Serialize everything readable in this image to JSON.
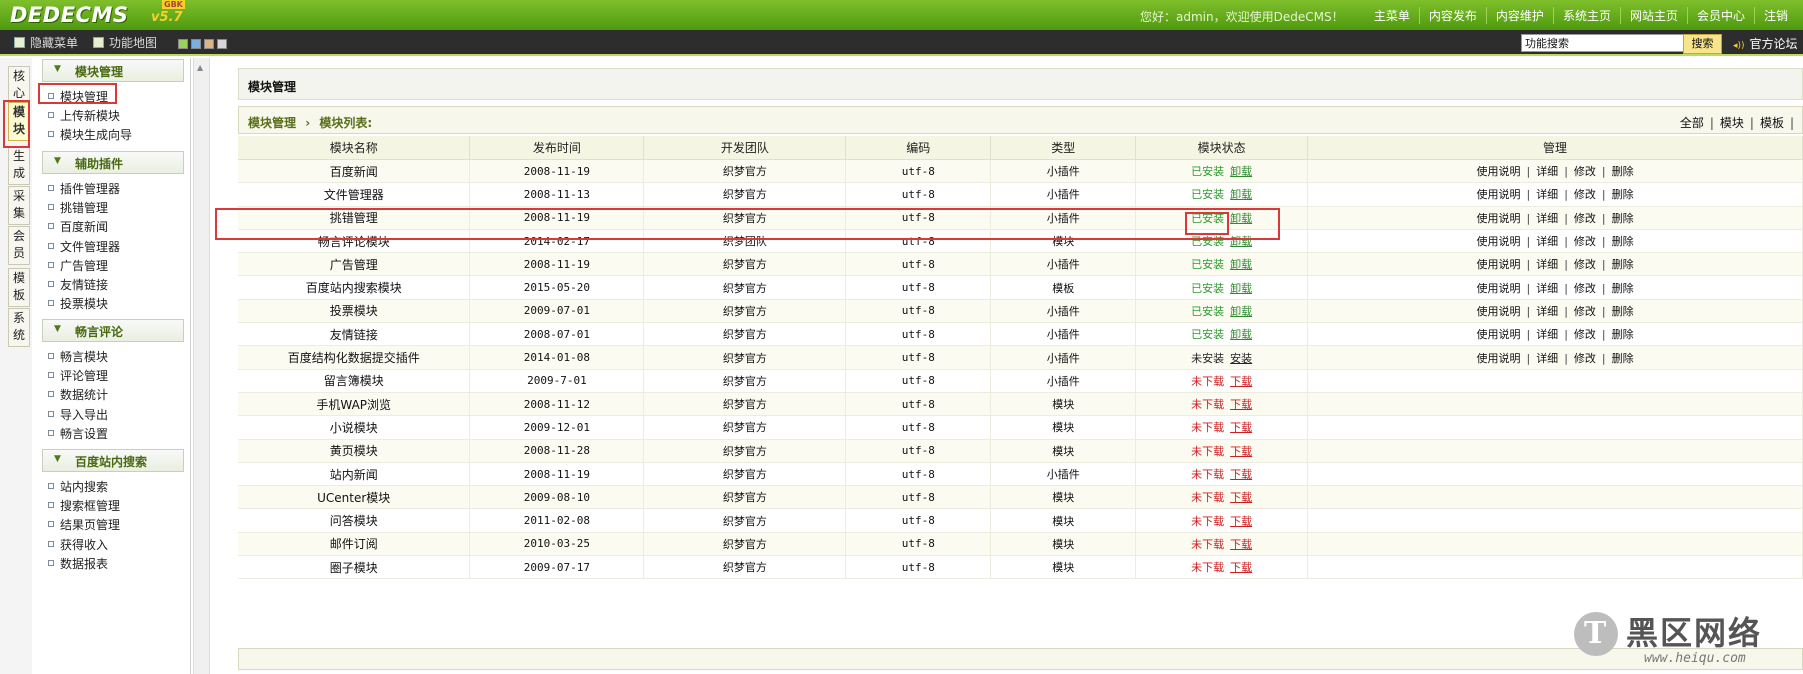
{
  "header": {
    "logo_text": "DEDECMS",
    "logo_version": "v5.7",
    "logo_badge": "GBK",
    "welcome": "您好：admin，欢迎使用DedeCMS！",
    "nav": [
      "主菜单",
      "内容发布",
      "内容维护",
      "系统主页",
      "网站主页",
      "会员中心",
      "注销"
    ]
  },
  "toolbar": {
    "hide_menu": "隐藏菜单",
    "function_map": "功能地图",
    "swatch_colors": [
      "#9bd05a",
      "#7ab0e0",
      "#d8b48a",
      "#d6d6d6"
    ],
    "search_value": "功能搜索",
    "search_button": "搜索",
    "forum_link": "官方论坛"
  },
  "vertical_tabs": [
    "核心",
    "模块",
    "生成",
    "采集",
    "会员",
    "模板",
    "系统"
  ],
  "sidebar": {
    "groups": [
      {
        "title": "模块管理",
        "items": [
          "模块管理",
          "上传新模块",
          "模块生成向导"
        ]
      },
      {
        "title": "辅助插件",
        "items": [
          "插件管理器",
          "挑错管理",
          "百度新闻",
          "文件管理器",
          "广告管理",
          "友情链接",
          "投票模块"
        ]
      },
      {
        "title": "畅言评论",
        "items": [
          "畅言模块",
          "评论管理",
          "数据统计",
          "导入导出",
          "畅言设置"
        ]
      },
      {
        "title": "百度站内搜索",
        "items": [
          "站内搜索",
          "搜索框管理",
          "结果页管理",
          "获得收入",
          "数据报表"
        ]
      }
    ]
  },
  "main": {
    "title": "模块管理",
    "crumb_root": "模块管理",
    "crumb_sep": "›",
    "crumb_current": "模块列表:",
    "filters": [
      "全部",
      "模块",
      "模板"
    ],
    "columns": [
      "模块名称",
      "发布时间",
      "开发团队",
      "编码",
      "类型",
      "模块状态",
      "管理"
    ],
    "manage_links": [
      "使用说明",
      "详细",
      "修改",
      "删除"
    ],
    "rows": [
      {
        "name": "百度新闻",
        "date": "2008-11-19",
        "team": "织梦官方",
        "enc": "utf-8",
        "type": "小插件",
        "status": "已安装",
        "action": "卸载",
        "state": "installed"
      },
      {
        "name": "文件管理器",
        "date": "2008-11-13",
        "team": "织梦官方",
        "enc": "utf-8",
        "type": "小插件",
        "status": "已安装",
        "action": "卸载",
        "state": "installed"
      },
      {
        "name": "挑错管理",
        "date": "2008-11-19",
        "team": "织梦官方",
        "enc": "utf-8",
        "type": "小插件",
        "status": "已安装",
        "action": "卸载",
        "state": "installed"
      },
      {
        "name": "畅言评论模块",
        "date": "2014-02-17",
        "team": "织梦团队",
        "enc": "utf-8",
        "type": "模块",
        "status": "已安装",
        "action": "卸载",
        "state": "installed"
      },
      {
        "name": "广告管理",
        "date": "2008-11-19",
        "team": "织梦官方",
        "enc": "utf-8",
        "type": "小插件",
        "status": "已安装",
        "action": "卸载",
        "state": "installed"
      },
      {
        "name": "百度站内搜索模块",
        "date": "2015-05-20",
        "team": "织梦官方",
        "enc": "utf-8",
        "type": "模板",
        "status": "已安装",
        "action": "卸载",
        "state": "installed"
      },
      {
        "name": "投票模块",
        "date": "2009-07-01",
        "team": "织梦官方",
        "enc": "utf-8",
        "type": "小插件",
        "status": "已安装",
        "action": "卸载",
        "state": "installed"
      },
      {
        "name": "友情链接",
        "date": "2008-07-01",
        "team": "织梦官方",
        "enc": "utf-8",
        "type": "小插件",
        "status": "已安装",
        "action": "卸载",
        "state": "installed"
      },
      {
        "name": "百度结构化数据提交插件",
        "date": "2014-01-08",
        "team": "织梦官方",
        "enc": "utf-8",
        "type": "小插件",
        "status": "未安装",
        "action": "安装",
        "state": "uninstalled"
      },
      {
        "name": "留言簿模块",
        "date": "2009-7-01",
        "team": "织梦官方",
        "enc": "utf-8",
        "type": "小插件",
        "status": "未下载",
        "action": "下载",
        "state": "not_downloaded"
      },
      {
        "name": "手机WAP浏览",
        "date": "2008-11-12",
        "team": "织梦官方",
        "enc": "utf-8",
        "type": "模块",
        "status": "未下载",
        "action": "下载",
        "state": "not_downloaded"
      },
      {
        "name": "小说模块",
        "date": "2009-12-01",
        "team": "织梦官方",
        "enc": "utf-8",
        "type": "模块",
        "status": "未下载",
        "action": "下载",
        "state": "not_downloaded"
      },
      {
        "name": "黄页模块",
        "date": "2008-11-28",
        "team": "织梦官方",
        "enc": "utf-8",
        "type": "模块",
        "status": "未下载",
        "action": "下载",
        "state": "not_downloaded"
      },
      {
        "name": "站内新闻",
        "date": "2008-11-19",
        "team": "织梦官方",
        "enc": "utf-8",
        "type": "小插件",
        "status": "未下载",
        "action": "下载",
        "state": "not_downloaded"
      },
      {
        "name": "UCenter模块",
        "date": "2009-08-10",
        "team": "织梦官方",
        "enc": "utf-8",
        "type": "模块",
        "status": "未下载",
        "action": "下载",
        "state": "not_downloaded"
      },
      {
        "name": "问答模块",
        "date": "2011-02-08",
        "team": "织梦官方",
        "enc": "utf-8",
        "type": "模块",
        "status": "未下载",
        "action": "下载",
        "state": "not_downloaded"
      },
      {
        "name": "邮件订阅",
        "date": "2010-03-25",
        "team": "织梦官方",
        "enc": "utf-8",
        "type": "模块",
        "status": "未下载",
        "action": "下载",
        "state": "not_downloaded"
      },
      {
        "name": "圈子模块",
        "date": "2009-07-17",
        "team": "织梦官方",
        "enc": "utf-8",
        "type": "模块",
        "status": "未下载",
        "action": "下载",
        "state": "not_downloaded"
      }
    ]
  },
  "watermark": {
    "big": "黑区网络",
    "url": "www.heiqu.com",
    "mark": "T"
  },
  "colors": {
    "installed": "#2f9a2f",
    "not_downloaded": "#cc1f1f",
    "highlight": "#d83a3a",
    "header_green": "#5aa317"
  }
}
